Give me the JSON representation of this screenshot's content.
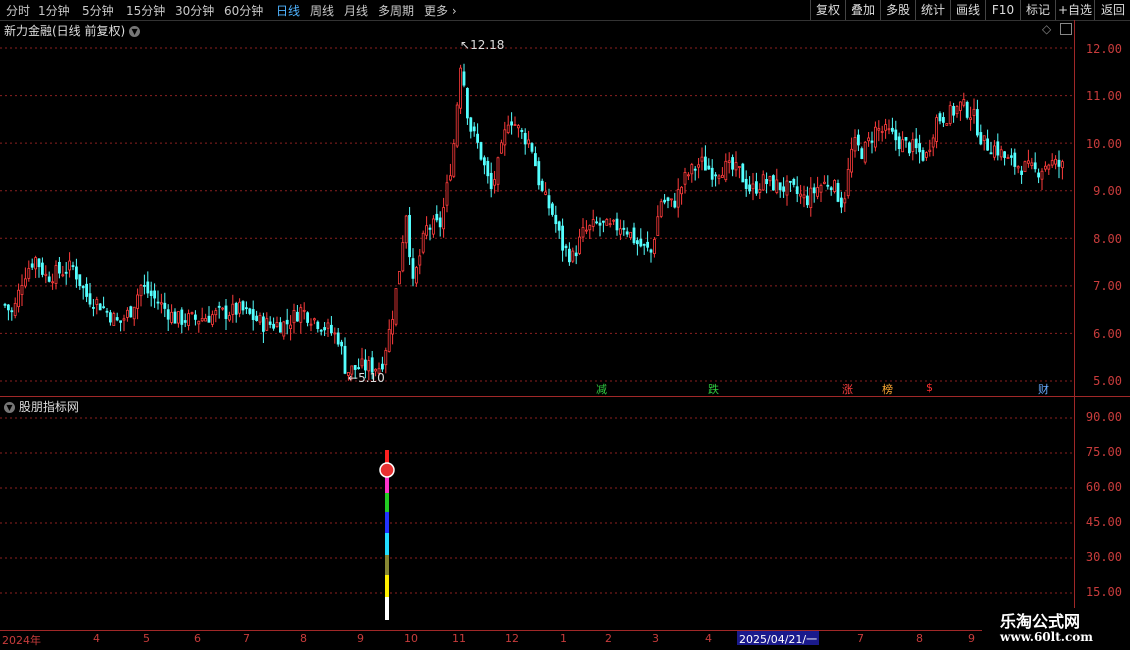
{
  "toolbar": {
    "tabs": [
      "分时",
      "1分钟",
      "5分钟",
      "15分钟",
      "30分钟",
      "60分钟",
      "日线",
      "周线",
      "月线",
      "多周期",
      "更多"
    ],
    "active_tab": "日线",
    "right_buttons": [
      "复权",
      "叠加",
      "多股",
      "统计",
      "画线",
      "F10",
      "标记",
      "+自选",
      "返回"
    ]
  },
  "main_panel": {
    "title": "新力金融(日线 前复权)",
    "y_labels": [
      "12.00",
      "11.00",
      "10.00",
      "9.00",
      "8.00",
      "7.00",
      "6.00",
      "5.00"
    ],
    "high_label": "12.18",
    "low_label": "5.10",
    "event_tags": [
      {
        "text": "减",
        "color": "#2ecc40"
      },
      {
        "text": "跌",
        "color": "#2ecc40"
      },
      {
        "text": "涨",
        "color": "#ff4040"
      },
      {
        "text": "榜",
        "color": "#ffaa33"
      },
      {
        "text": "$",
        "color": "#ff3030"
      },
      {
        "text": "财",
        "color": "#66aaff"
      }
    ]
  },
  "indicator_panel": {
    "title": "股朋指标网",
    "y_labels": [
      "90.00",
      "75.00",
      "60.00",
      "45.00",
      "30.00",
      "15.00"
    ]
  },
  "x_axis": {
    "labels": [
      "2024年",
      "4",
      "5",
      "6",
      "7",
      "8",
      "9",
      "10",
      "11",
      "12",
      "1",
      "2",
      "3",
      "4",
      "7",
      "8",
      "9"
    ],
    "cursor_date": "2025/04/21/一"
  },
  "watermark": {
    "line1": "乐淘公式网",
    "line2": "www.60lt.com"
  },
  "colors": {
    "up": "#ff3c3c",
    "down": "#54ffff",
    "grid": "#8b2020",
    "axis": "#c83c3c",
    "active_tab": "#4fb3ff"
  }
}
